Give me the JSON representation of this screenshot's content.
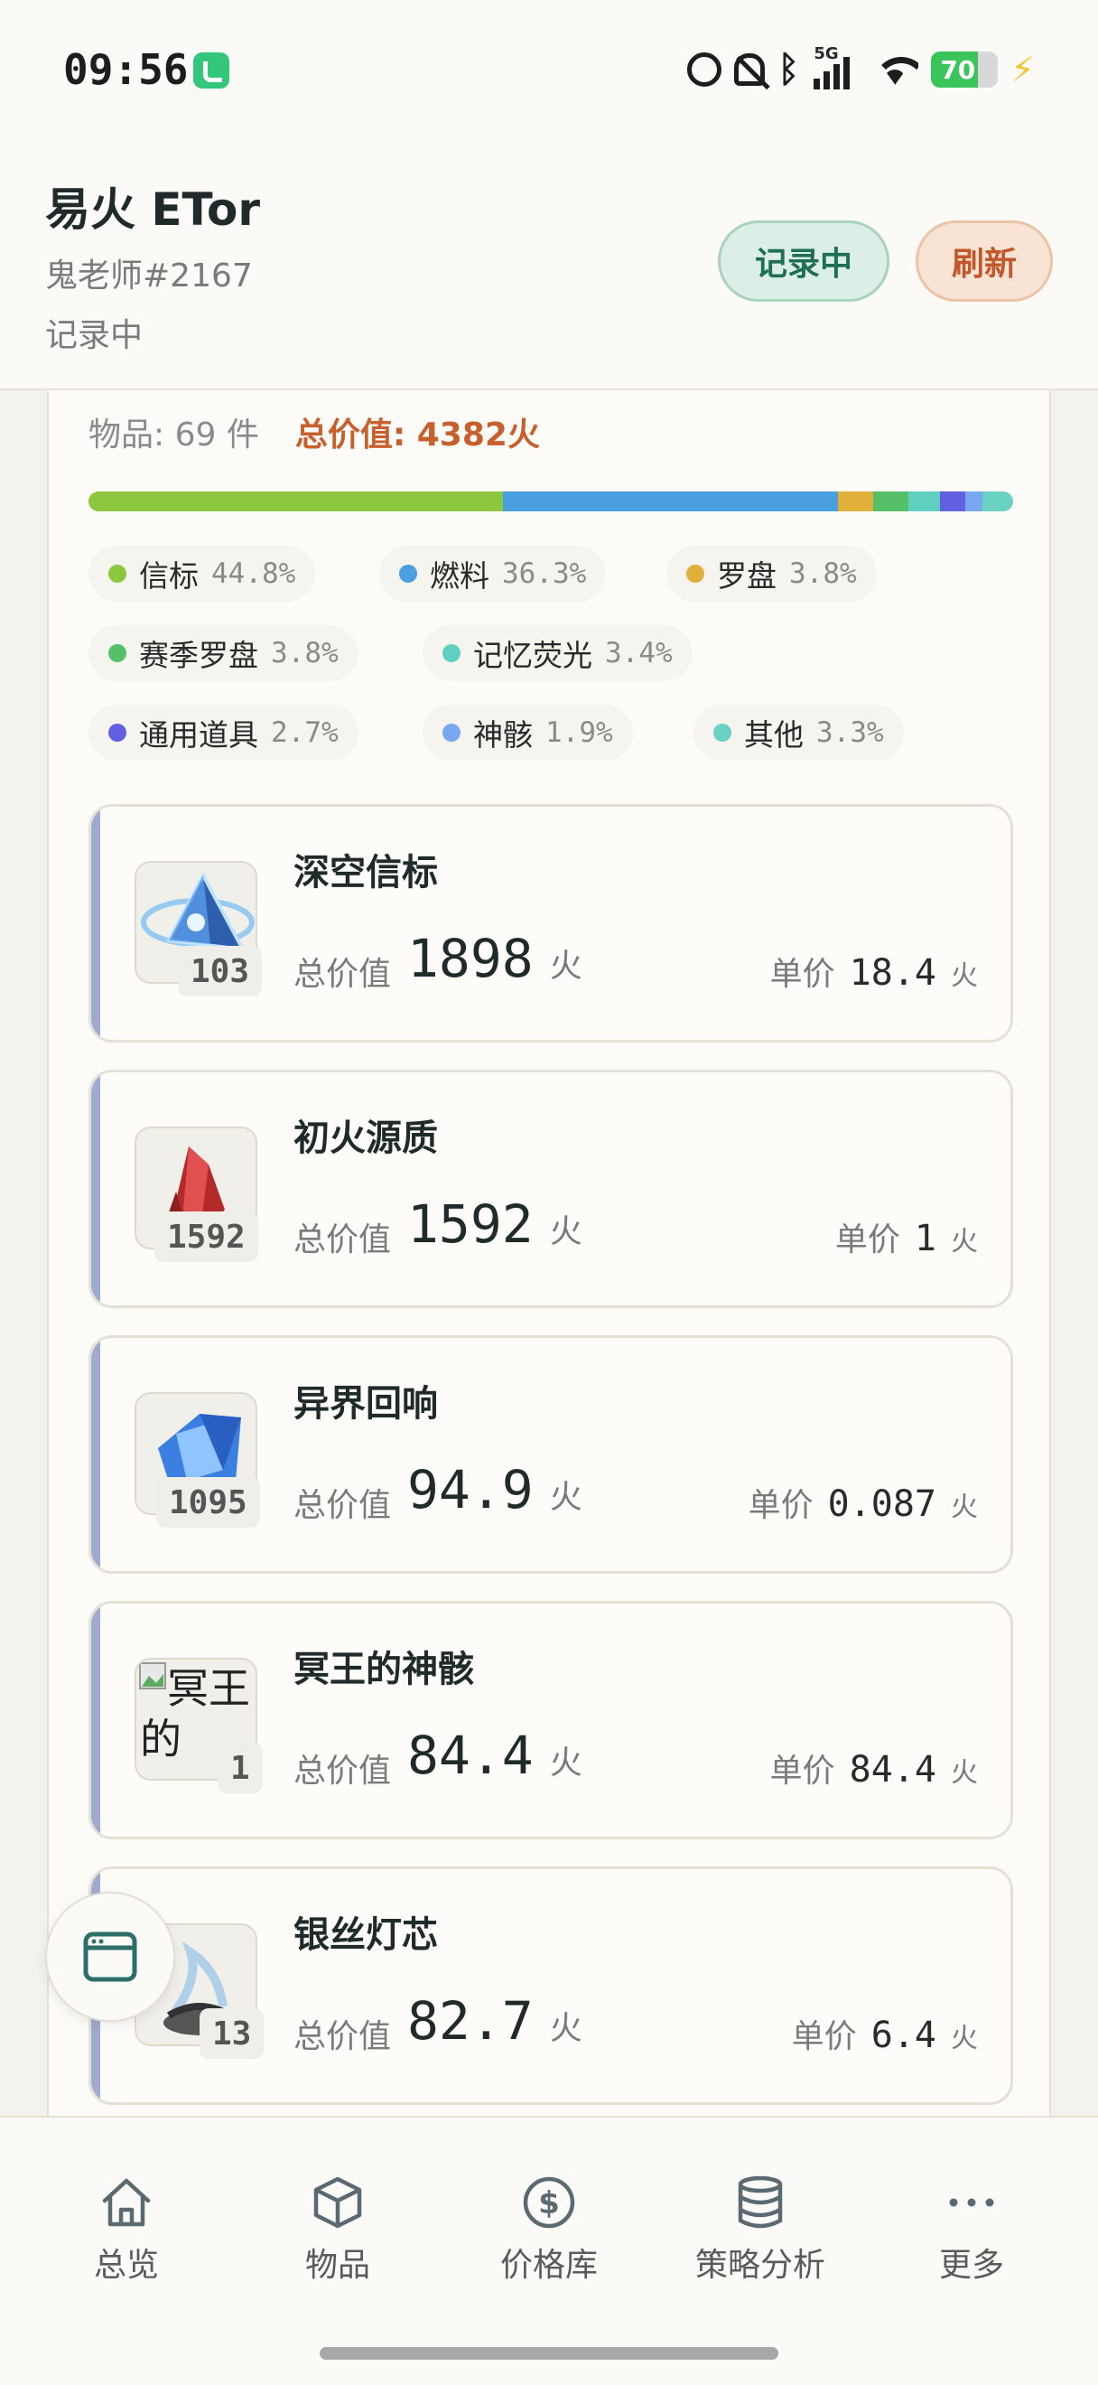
{
  "status_bar": {
    "time": "09:56",
    "battery": "70",
    "battery_level": 0.7,
    "network": "5G"
  },
  "header": {
    "title": "易火 ETor",
    "user": "鬼老师#2167",
    "status": "记录中",
    "record_button": "记录中",
    "refresh_button": "刷新"
  },
  "summary": {
    "count_label": "物品: 69 件",
    "total_label": "总价值: 4382火"
  },
  "categories": [
    {
      "name": "信标",
      "pct": "44.8%",
      "share": 44.8,
      "color": "#8dc63f"
    },
    {
      "name": "燃料",
      "pct": "36.3%",
      "share": 36.3,
      "color": "#4a9fe0"
    },
    {
      "name": "罗盘",
      "pct": "3.8%",
      "share": 3.8,
      "color": "#e0b03a"
    },
    {
      "name": "赛季罗盘",
      "pct": "3.8%",
      "share": 3.8,
      "color": "#55bf6a"
    },
    {
      "name": "记忆荧光",
      "pct": "3.4%",
      "share": 3.4,
      "color": "#5fd0c0"
    },
    {
      "name": "通用道具",
      "pct": "2.7%",
      "share": 2.7,
      "color": "#6060e0"
    },
    {
      "name": "神骸",
      "pct": "1.9%",
      "share": 1.9,
      "color": "#7aa8f0"
    },
    {
      "name": "其他",
      "pct": "3.3%",
      "share": 3.3,
      "color": "#6ad2c2"
    }
  ],
  "items": [
    {
      "name": "深空信标",
      "qty": "103",
      "total_label": "总价值",
      "total": "1898",
      "unit": "火",
      "price_label": "单价",
      "price": "18.4",
      "icon": "beacon-icon"
    },
    {
      "name": "初火源质",
      "qty": "1592",
      "total_label": "总价值",
      "total": "1592",
      "unit": "火",
      "price_label": "单价",
      "price": "1",
      "icon": "red-crystal-icon"
    },
    {
      "name": "异界回响",
      "qty": "1095",
      "total_label": "总价值",
      "total": "94.9",
      "unit": "火",
      "price_label": "单价",
      "price": "0.087",
      "icon": "blue-crystal-icon"
    },
    {
      "name": "冥王的神骸",
      "qty": "1",
      "total_label": "总价值",
      "total": "84.4",
      "unit": "火",
      "price_label": "单价",
      "price": "84.4",
      "icon": "broken-image-icon",
      "alt": "冥王的"
    },
    {
      "name": "银丝灯芯",
      "qty": "13",
      "total_label": "总价值",
      "total": "82.7",
      "unit": "火",
      "price_label": "单价",
      "price": "6.4",
      "icon": "wick-icon"
    }
  ],
  "nav": [
    {
      "label": "总览",
      "icon": "home-icon"
    },
    {
      "label": "物品",
      "icon": "box-icon"
    },
    {
      "label": "价格库",
      "icon": "dollar-icon"
    },
    {
      "label": "策略分析",
      "icon": "database-icon"
    },
    {
      "label": "更多",
      "icon": "more-icon"
    }
  ]
}
